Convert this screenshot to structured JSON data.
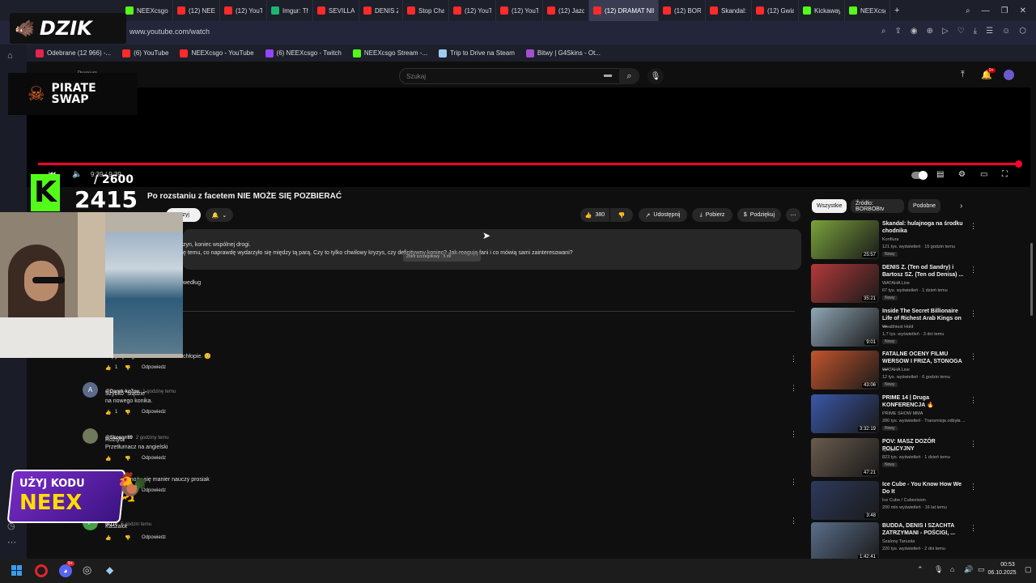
{
  "browser": {
    "tabs": [
      {
        "label": "NEEXcsgo",
        "favicon": "kick"
      },
      {
        "label": "(12) NEEX",
        "favicon": "yt"
      },
      {
        "label": "(12) YouTu",
        "favicon": "yt"
      },
      {
        "label": "Imgur: The",
        "favicon": "img"
      },
      {
        "label": "SEVILLA N",
        "favicon": "yt"
      },
      {
        "label": "DENIS ZA",
        "favicon": "yt"
      },
      {
        "label": "Stop Cham",
        "favicon": "yt"
      },
      {
        "label": "(12) YouTu",
        "favicon": "yt"
      },
      {
        "label": "(12) YouTu",
        "favicon": "yt"
      },
      {
        "label": "(12) Jazda",
        "favicon": "yt"
      },
      {
        "label": "(12) DRAMAT NIKI",
        "favicon": "yt",
        "active": true
      },
      {
        "label": "(12) BORB",
        "favicon": "yt"
      },
      {
        "label": "Skandal: h",
        "favicon": "yt"
      },
      {
        "label": "(12) Gwiaz",
        "favicon": "yt"
      },
      {
        "label": "Kickaway",
        "favicon": "kick"
      },
      {
        "label": "NEEXcsgo",
        "favicon": "kick"
      }
    ],
    "new_tab": "+",
    "url": "www.youtube.com/watch",
    "bookmarks": [
      {
        "label": "Odebrane (12 966) -...",
        "icon": "mail-icon"
      },
      {
        "label": "(6) YouTube",
        "icon": "youtube-icon"
      },
      {
        "label": "NEEXcsgo - YouTube",
        "icon": "youtube-icon"
      },
      {
        "label": "(6) NEEXcsgo - Twitch",
        "icon": "twitch-icon"
      },
      {
        "label": "NEEXcsgo Stream -...",
        "icon": "kick-icon"
      },
      {
        "label": "Trip to Drive na Steam",
        "icon": "steam-icon"
      },
      {
        "label": "Bitwy | G4Skins - Ot...",
        "icon": "gem-icon"
      }
    ]
  },
  "overlay": {
    "brand": "DZIK",
    "sponsor": [
      "PIRATE",
      "SWAP"
    ],
    "kick_goal_current": "2415",
    "kick_goal_target": "/ 2600",
    "promo_line1": "UŻYJ KODU",
    "promo_line2": "NEEX"
  },
  "youtube": {
    "search_placeholder": "Szukaj",
    "premium_label": "Premium",
    "player": {
      "time": "9:39 / 9:39",
      "progress_fraction": 1.0
    },
    "video_title": "Po rozstaniu z facetem NIE MOŻE SIĘ POZBIERAĆ",
    "subscribe_label": "przyj",
    "actions": {
      "likes": "380",
      "share": "Udostępnij",
      "download": "Pobierz",
      "thanks": "Podziękuj"
    },
    "description": [
      "zyn, koniec wspólnej drogi.",
      "ę temu, co naprawdę wydarzyło się między tą parą. Czy to tylko chwilowy kryzys, czy definitywny koniec? Jak reagują fani i co mówią sami zainteresowani?"
    ],
    "tooltip": "Zbiór szczegółowy · 5 ról",
    "sort_label": "według",
    "comments": [
      {
        "author": "",
        "time": "",
        "text": "Zapytaj kogoś i SPROSTUJ to chłopie. 😊",
        "likes": "1",
        "reply": "Odpowiedz",
        "avatar_letter": "",
        "avatar_color": "#555555"
      },
      {
        "author": "@Darek-ko7ou",
        "time": "1 godzinę temu",
        "text": "Szybko \"siądzie\"\nna nowego konika.",
        "likes": "1",
        "reply": "Odpowiedz",
        "avatar_letter": "A",
        "avatar_color": "#5c6b8a"
      },
      {
        "author": "@Skowyr89",
        "time": "2 godziny temu",
        "text": "Roztyta\nPrzetłumacz na angielski",
        "likes": "",
        "reply": "Odpowiedz",
        "avatar_letter": "",
        "avatar_color": "#6e7a5a"
      },
      {
        "author": "",
        "time": "",
        "text": "wiczenia może się manier nauczy prosiak",
        "likes": "",
        "reply": "Odpowiedz",
        "avatar_letter": "",
        "avatar_color": "#555555"
      },
      {
        "author": "to11c",
        "time": "5 godzin temu",
        "text": "Kaszalot",
        "likes": "",
        "reply": "Odpowiedz",
        "avatar_letter": "P",
        "avatar_color": "#43a047"
      }
    ],
    "chips": [
      "Wszystkie",
      "Źródło: BORBOBtv",
      "Podobne"
    ],
    "recommended": [
      {
        "title": "Skandal: hulajnoga na środku chodnika",
        "channel": "Konfiura",
        "views": "121 tys. wyświetleń · 15 godzin temu",
        "badge": "Nowy",
        "duration": "25:57",
        "color": "#7aa23c"
      },
      {
        "title": "DENIS Z. (Ten od Sandry) i Bartosz SZ. (Ten od Denisa) ...",
        "channel": "WATAHA Live",
        "views": "67 tys. wyświetleń · 1 dzień temu",
        "badge": "Nowy",
        "duration": "35:21",
        "color": "#b23a3a"
      },
      {
        "title": "Inside The Secret Billionaire Life of Richest Arab Kings on ...",
        "channel": "Wealthiest Hold",
        "views": "1,7 tys. wyświetleń · 3 dni temu",
        "badge": "Nowy",
        "duration": "9:01",
        "color": "#8fa6b5"
      },
      {
        "title": "FATALNE OCENY FILMU WERSOW I FRIZA, STONOGA ...",
        "channel": "WATAHA Live",
        "views": "12 tys. wyświetleń · 6 godzin temu",
        "badge": "Nowy",
        "duration": "43:06",
        "color": "#c2552d"
      },
      {
        "title": "PRIME 14 | Druga KONFERENCJA 🔥",
        "channel": "PRIME SHOW MMA",
        "views": "280 tys. wyświetleń · Transmisja odbyła ...",
        "badge": "Nowy",
        "duration": "3:32:19",
        "color": "#3b57a8"
      },
      {
        "title": "POV: MASZ DOZÓR POLICYJNY",
        "channel": "ojwojtek",
        "views": "823 tys. wyświetleń · 1 dzień temu",
        "badge": "Nowy",
        "duration": "47:21",
        "color": "#6a5b4d"
      },
      {
        "title": "Ice Cube - You Know How We Do It",
        "channel": "Ice Cube / Cubevision",
        "views": "200 mln wyświetleń · 16 lat temu",
        "badge": "",
        "duration": "3:48",
        "color": "#2d3a5c"
      },
      {
        "title": "BUDDA, DENIS I SZACHTA ZATRZYMANI - POŚCIGI, ...",
        "channel": "Szalony Tanuola",
        "views": "220 tys. wyświetleń · 2 dni temu",
        "badge": "",
        "duration": "1:42:41",
        "color": "#5a6e8a"
      }
    ]
  },
  "taskbar": {
    "time": "00:53",
    "date": "06.10.2025",
    "discord_badge": "9+"
  }
}
